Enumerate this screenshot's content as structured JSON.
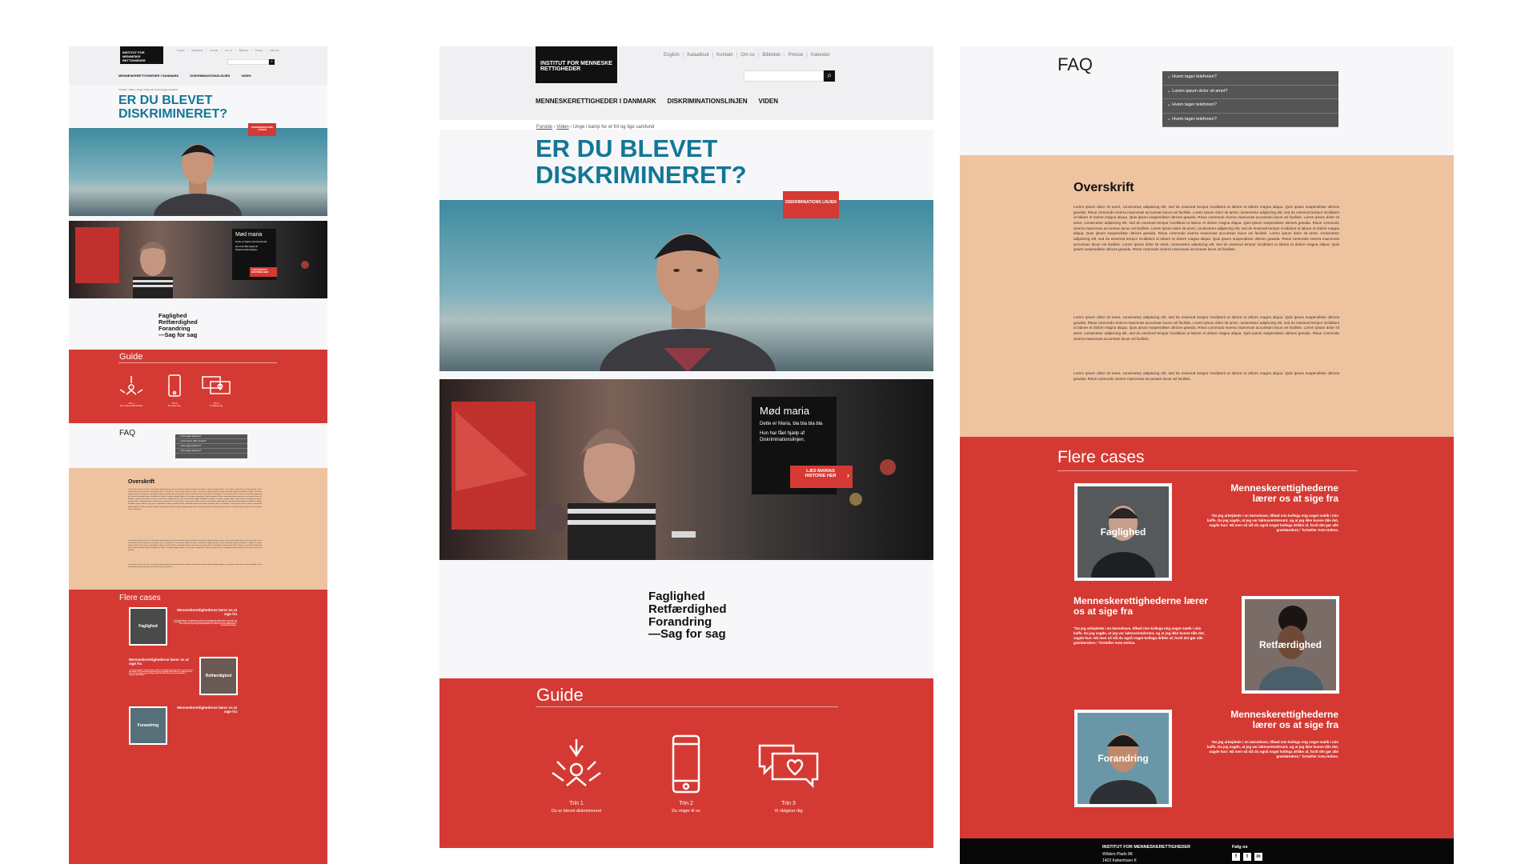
{
  "header": {
    "logo_text": "INSTITUT FOR MENNESKE RETTIGHEDER",
    "top_nav": [
      "English",
      "Kalaallisut",
      "Kontakt",
      "Om os",
      "Bibliotek",
      "Presse",
      "Kalender"
    ],
    "main_nav": [
      "MENNESKERETTIGHEDER I DANMARK",
      "DISKRIMINATIONSLINJEN",
      "VIDEN"
    ],
    "search_placeholder": ""
  },
  "breadcrumb": [
    "Forside",
    "Viden",
    "Unge i kamp for et frit og lige samfund"
  ],
  "hero": {
    "headline_line1": "ER DU BLEVET",
    "headline_line2": "DISKRIMINERET?",
    "badge": "DISKRIMINATIONS LINJEN"
  },
  "maria": {
    "title": "Mød maria",
    "text1": "Dette er Maria, bla bla bla bla",
    "text2": "Hun har fået hjælp af Diskriminationslinjen.",
    "button": "LÆS MARIAS HISTORIE HER"
  },
  "slogan": [
    "Faglighed",
    "Retfærdighed",
    "Forandring",
    "—Sag for sag"
  ],
  "guide": {
    "title": "Guide",
    "steps": [
      {
        "label": "Trin 1",
        "sub": "Du er blevet diskrimineret",
        "icon": "hands-helping-icon"
      },
      {
        "label": "Trin 2",
        "sub": "Du ringer til os",
        "icon": "phone-icon"
      },
      {
        "label": "Trin 3",
        "sub": "Vi rådgiver dig",
        "icon": "chat-heart-icon"
      }
    ]
  },
  "faq": {
    "title": "FAQ",
    "items": [
      "Hvem tager telefonen?",
      "Lorem ipsum dolor sit amet?",
      "Hvem tager telefonen?",
      "Hvem tager telefonen?"
    ]
  },
  "overskrift": {
    "title": "Overskrift",
    "para1": "Lorem ipsum dolor sit amet, consectetur adipiscing elit, sed do eiusmod tempor incididunt ut labore et dolore magna aliqua. Quis ipsum suspendisse ultrices gravida. Risus commodo viverra maecenas accumsan lacus vel facilisis. Lorem ipsum dolor sit amet, consectetur adipiscing elit, sed do eiusmod tempor incididunt ut labore et dolore magna aliqua. Quis ipsum suspendisse ultrices gravida. Risus commodo viverra maecenas accumsan lacus vel facilisis. Lorem ipsum dolor sit amet, consectetur adipiscing elit, sed do eiusmod tempor incididunt ut labore et dolore magna aliqua. Quis ipsum suspendisse ultrices gravida. Risus commodo viverra maecenas accumsan lacus vel facilisis. Lorem ipsum dolor sit amet, consectetur adipiscing elit, sed do eiusmod tempor incididunt ut labore et dolore magna aliqua. Quis ipsum suspendisse ultrices gravida. Risus commodo viverra maecenas accumsan lacus vel facilisis. Lorem ipsum dolor sit amet, consectetur adipiscing elit, sed do eiusmod tempor incididunt ut labore et dolore magna aliqua. Quis ipsum suspendisse ultrices gravida. Risus commodo viverra maecenas accumsan lacus vel facilisis. Lorem ipsum dolor sit amet, consectetur adipiscing elit, sed do eiusmod tempor incididunt ut labore et dolore magna aliqua. Quis ipsum suspendisse ultrices gravida. Risus commodo viverra maecenas accumsan lacus vel facilisis.",
    "para2": "Lorem ipsum dolor sit amet, consectetur adipiscing elit, sed do eiusmod tempor incididunt ut labore et dolore magna aliqua. Quis ipsum suspendisse ultrices gravida. Risus commodo viverra maecenas accumsan lacus vel facilisis. Lorem ipsum dolor sit amet, consectetur adipiscing elit, sed do eiusmod tempor incididunt ut labore et dolore magna aliqua. Quis ipsum suspendisse ultrices gravida. Risus commodo viverra maecenas accumsan lacus vel facilisis. Lorem ipsum dolor sit amet, consectetur adipiscing elit, sed do eiusmod tempor incididunt ut labore et dolore magna aliqua. Quis ipsum suspendisse ultrices gravida. Risus commodo viverra maecenas accumsan lacus vel facilisis.",
    "para3": "Lorem ipsum dolor sit amet, consectetur adipiscing elit, sed do eiusmod tempor incididunt ut labore et dolore magna aliqua. Quis ipsum suspendisse ultrices gravida. Risus commodo viverra maecenas accumsan lacus vel facilisis."
  },
  "cases": {
    "title": "Flere cases",
    "heading": "Menneskerettighederne lærer os at sige fra",
    "quote": "\"Da jeg arbejdede i en børnehave, tilbød min kollega mig noget mælk i min kaffe. Da jeg sagde, at jeg var laktoseintolerant, og at jeg ikke kunne tåle det, sagde hun: Nå men så slå du også noget kollega drikke af, fordi det gør alle grønlændere,\" fortæller Asta Holms.",
    "items": [
      {
        "caption": "Faglighed"
      },
      {
        "caption": "Retfærdighed"
      },
      {
        "caption": "Forandring"
      }
    ]
  },
  "footer": {
    "org": "INSTITUT FOR MENNESKERETTIGHEDER",
    "addr1": "Wilders Plads 8K",
    "addr2": "1403 København K",
    "follow": "Følg os",
    "social": [
      "f",
      "t",
      "in"
    ]
  },
  "colors": {
    "accent_red": "#d43a33",
    "headline_blue": "#137795",
    "peach": "#eec3a0",
    "faq_gray": "#555555"
  }
}
